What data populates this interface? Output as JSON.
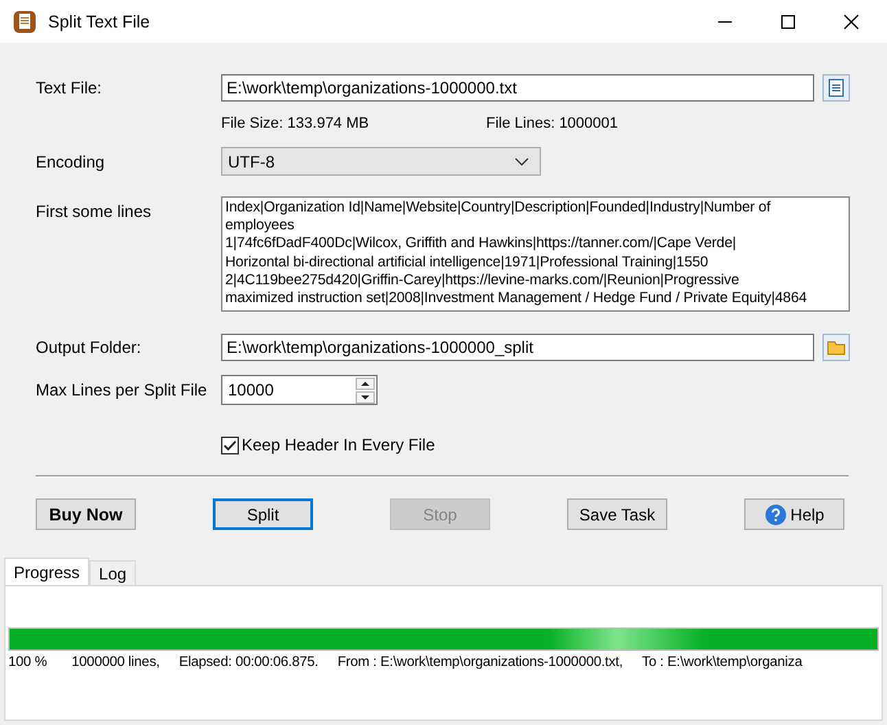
{
  "window": {
    "title": "Split Text File"
  },
  "text_file": {
    "label": "Text File:",
    "value": "E:\\work\\temp\\organizations-1000000.txt"
  },
  "file_info": [
    {
      "label": "File Size:",
      "value": "133.974 MB"
    },
    {
      "label": "File Lines:",
      "value": "1000001"
    }
  ],
  "encoding": {
    "label": "Encoding",
    "value": "UTF-8"
  },
  "preview": {
    "label": "First some lines",
    "lines": [
      "Index|Organization Id|Name|Website|Country|Description|Founded|Industry|Number of",
      "employees",
      "1|74fc6fDadF400Dc|Wilcox, Griffith and Hawkins|https://tanner.com/|Cape Verde|",
      "Horizontal bi-directional artificial intelligence|1971|Professional Training|1550",
      "2|4C119bee275d420|Griffin-Carey|https://levine-marks.com/|Reunion|Progressive",
      "maximized instruction set|2008|Investment Management / Hedge Fund / Private Equity|4864"
    ]
  },
  "output_folder": {
    "label": "Output Folder:",
    "value": "E:\\work\\temp\\organizations-1000000_split"
  },
  "max_lines": {
    "label": "Max Lines per Split File",
    "value": "10000"
  },
  "keep_header": {
    "label": "Keep Header In Every File",
    "checked": true
  },
  "buttons": [
    {
      "label": "Buy Now",
      "kind": "bold",
      "disabled": false
    },
    {
      "label": "Split",
      "kind": "default",
      "disabled": false
    },
    {
      "label": "Stop",
      "kind": "plain",
      "disabled": true
    },
    {
      "label": "Save Task",
      "kind": "plain",
      "disabled": false
    },
    {
      "label": "Help",
      "kind": "help",
      "disabled": false
    }
  ],
  "tabs": [
    {
      "label": "Progress",
      "selected": true
    },
    {
      "label": "Log",
      "selected": false
    }
  ],
  "progress": {
    "level": 1,
    "status": [
      "100 %",
      "1000000 lines,",
      "Elapsed: 00:00:06.875.",
      "From : E:\\work\\temp\\organizations-1000000.txt,",
      "To : E:\\work\\temp\\organiza"
    ]
  }
}
